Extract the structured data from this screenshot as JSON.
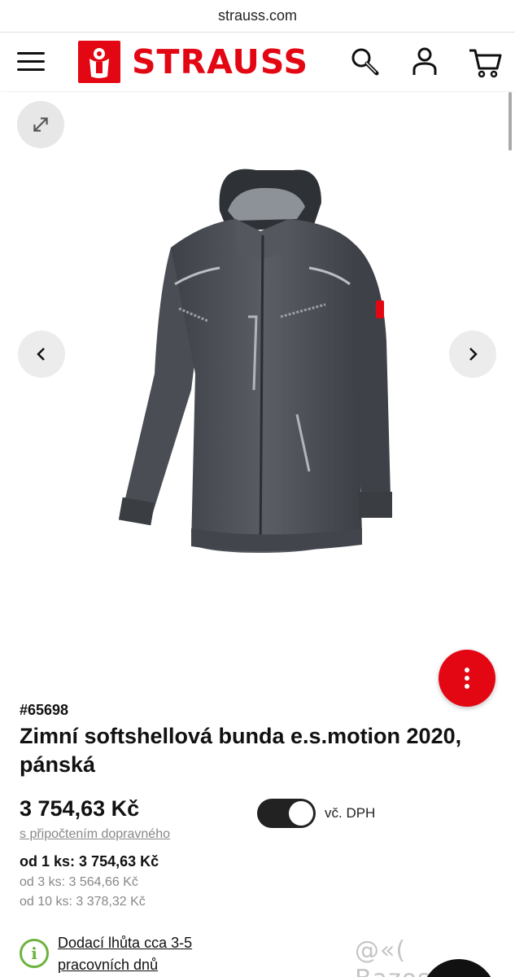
{
  "browser": {
    "url": "strauss.com"
  },
  "header": {
    "logo_text": "STRAUSS",
    "brand_color": "#e30613",
    "icons": [
      "menu-icon",
      "search-icon",
      "account-icon",
      "cart-icon"
    ]
  },
  "gallery": {
    "expand_icon": "expand-icon",
    "prev_icon": "chevron-left-icon",
    "next_icon": "chevron-right-icon",
    "more_icon": "more-vertical-icon"
  },
  "product": {
    "sku": "#65698",
    "title": "Zimní softshellová bunda e.s.motion 2020, pánská",
    "price": "3 754,63 Kč",
    "shipping_note": "s připočtením dopravného",
    "vat_toggle_label": "vč. DPH",
    "vat_toggle_on": true,
    "tiers": [
      {
        "label": "od 1 ks:",
        "price": "3 754,63 Kč"
      },
      {
        "label": "od 3 ks:",
        "price": "3 564,66 Kč"
      },
      {
        "label": "od 10 ks:",
        "price": "3 378,32 Kč"
      }
    ],
    "delivery": "Dodací lhůta cca 3-5 pracovních dnů"
  },
  "watermark": "@«( Bazos.cz"
}
